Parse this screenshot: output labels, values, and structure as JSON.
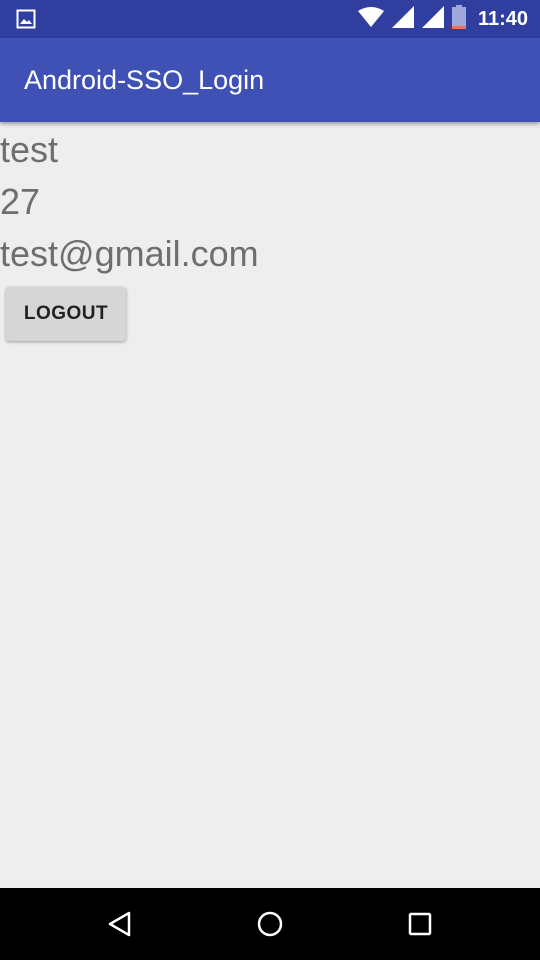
{
  "status_bar": {
    "time": "11:40",
    "icons": [
      "image-notification-icon",
      "wifi-icon",
      "signal-icon",
      "signal-icon",
      "battery-icon"
    ],
    "color": "#303f9f"
  },
  "app_bar": {
    "title": "Android-SSO_Login",
    "color": "#3f51b5"
  },
  "profile": {
    "name": "test",
    "age": "27",
    "email": "test@gmail.com"
  },
  "actions": {
    "logout_label": "LOGOUT"
  },
  "nav_bar": {
    "buttons": [
      "back-icon",
      "home-icon",
      "recents-icon"
    ]
  }
}
